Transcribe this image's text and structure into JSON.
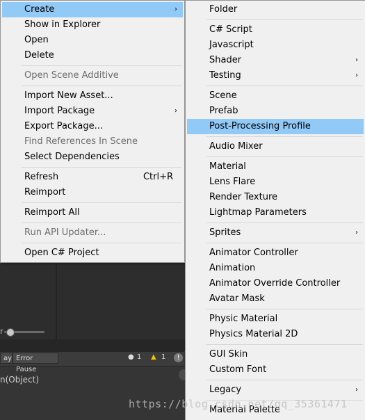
{
  "left_menu": {
    "items": [
      {
        "label": "Create",
        "arrow": "›",
        "selected": true
      },
      {
        "label": "Show in Explorer"
      },
      {
        "label": "Open"
      },
      {
        "label": "Delete"
      },
      {
        "label": "Open Scene Additive",
        "disabled": true
      },
      {
        "label": "Import New Asset..."
      },
      {
        "label": "Import Package",
        "arrow": "›"
      },
      {
        "label": "Export Package..."
      },
      {
        "label": "Find References In Scene",
        "disabled": true
      },
      {
        "label": "Select Dependencies"
      },
      {
        "label": "Refresh",
        "shortcut": "Ctrl+R"
      },
      {
        "label": "Reimport"
      },
      {
        "label": "Reimport All"
      },
      {
        "label": "Run API Updater...",
        "disabled": true
      },
      {
        "label": "Open C# Project"
      }
    ]
  },
  "right_menu": {
    "items": [
      {
        "label": "Folder"
      },
      {
        "label": "C# Script"
      },
      {
        "label": "Javascript"
      },
      {
        "label": "Shader",
        "arrow": "›"
      },
      {
        "label": "Testing",
        "arrow": "›"
      },
      {
        "label": "Scene"
      },
      {
        "label": "Prefab"
      },
      {
        "label": "Post-Processing Profile",
        "selected": true
      },
      {
        "label": "Audio Mixer"
      },
      {
        "label": "Material"
      },
      {
        "label": "Lens Flare"
      },
      {
        "label": "Render Texture"
      },
      {
        "label": "Lightmap Parameters"
      },
      {
        "label": "Sprites",
        "arrow": "›"
      },
      {
        "label": "Animator Controller"
      },
      {
        "label": "Animation"
      },
      {
        "label": "Animator Override Controller"
      },
      {
        "label": "Avatar Mask"
      },
      {
        "label": "Physic Material"
      },
      {
        "label": "Physics Material 2D"
      },
      {
        "label": "GUI Skin"
      },
      {
        "label": "Custom Font"
      },
      {
        "label": "Legacy",
        "arrow": "›"
      },
      {
        "label": "Material Palette"
      }
    ]
  },
  "background": {
    "slider_label": "r",
    "console_buttons": [
      "ay",
      "Error Pause"
    ],
    "console_counts": [
      "1",
      "1"
    ],
    "console_log": "n(Object)"
  },
  "watermark": "https://blog.csdn.net/qq_35361471",
  "colors": {
    "selection": "#91c9f7",
    "menu_bg": "#f0f0f0",
    "disabled_text": "#6d6d6d"
  }
}
